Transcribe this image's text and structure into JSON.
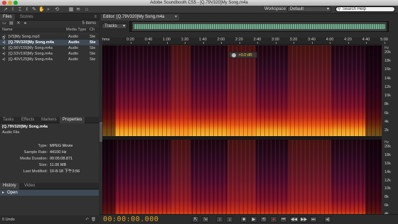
{
  "window": {
    "title": "Adobe Soundbooth CS5 - [Q.79V320]My Song.m4a"
  },
  "toolbar": {
    "workspace_label": "Workspace:",
    "workspace_value": "Default",
    "search_placeholder": "Search Help"
  },
  "files_panel": {
    "tabs": [
      "Files",
      "Scores"
    ],
    "items_count": "5 items",
    "columns": [
      "Name",
      "Media Type",
      "Ch"
    ],
    "rows": [
      {
        "name": "[V5]My Song.mp3",
        "type": "Audio",
        "ch": "Ste",
        "selected": false
      },
      {
        "name": "[Q.79V320]My Song.m4a",
        "type": "Audio",
        "ch": "Ste",
        "selected": true
      },
      {
        "name": "[Q.56V155]My Song.m4a",
        "type": "Audio",
        "ch": "Ste",
        "selected": false
      },
      {
        "name": "[Q.53V190]My Song.m4a",
        "type": "Audio",
        "ch": "Ste",
        "selected": false
      },
      {
        "name": "[Q.40V125]My Song.m4a",
        "type": "Audio",
        "ch": "Ste",
        "selected": false
      }
    ]
  },
  "properties_panel": {
    "tabs": [
      "Tasks",
      "Effects",
      "Markers",
      "Properties"
    ],
    "title": "[Q.79V320]My Song.m4a",
    "subtitle": "Audio File",
    "fields": [
      {
        "label": "Type:",
        "value": "MPEG Movie"
      },
      {
        "label": "Sample Rate:",
        "value": "44100 Hz"
      },
      {
        "label": "Media Duration:",
        "value": "00:05:08.871"
      },
      {
        "label": "Size:",
        "value": "11.06 MB"
      },
      {
        "label": "Last Modified:",
        "value": "10-8-18 下午3:56"
      }
    ]
  },
  "history_panel": {
    "tabs": [
      "History",
      "Video"
    ],
    "items": [
      "Open"
    ],
    "undo_count": "0 Undo"
  },
  "editor": {
    "tab_label": "Editor: [Q.79V320]My Song.m4a",
    "tracks_label": "Tracks",
    "ruler_label": "hms",
    "ruler_ticks": [
      "0:20",
      "0:40",
      "1:00",
      "1:20",
      "1:40",
      "2:00",
      "2:20",
      "2:40",
      "3:00",
      "3:20",
      "3:40",
      "4:00",
      "4:20",
      "4:40",
      "5:00"
    ],
    "volume_hud": "+0.0 dB",
    "freq_scale": [
      "Hz",
      "20k",
      "18k",
      "16k",
      "14k",
      "12k",
      "10k",
      "8k",
      "6k",
      "4k",
      "2k"
    ],
    "timecode": "00:00:00.000"
  },
  "colors": {
    "timecode": "#e2a026",
    "selection": "#3e4a57",
    "record": "#e03030"
  }
}
